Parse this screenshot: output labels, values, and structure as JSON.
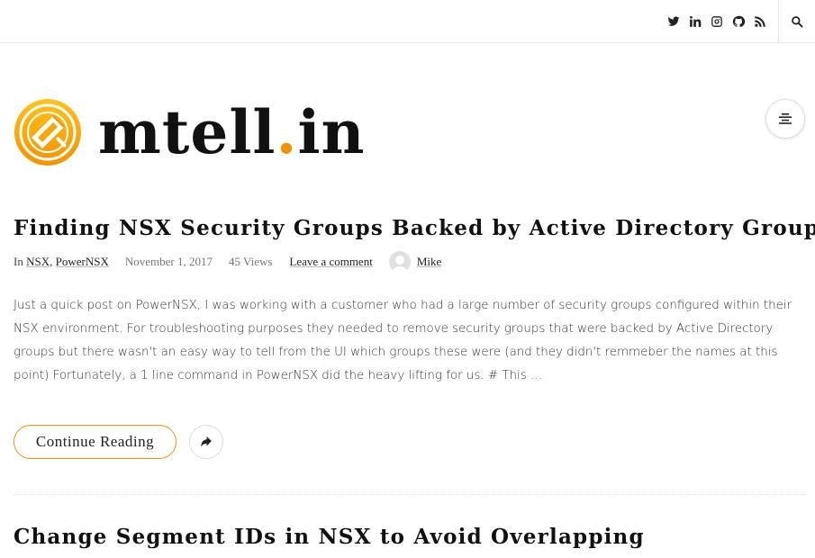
{
  "topbar": {
    "social_icons": [
      "twitter-icon",
      "linkedin-icon",
      "instagram-icon",
      "github-icon",
      "rss-icon"
    ],
    "search_icon": "search-icon"
  },
  "header": {
    "logo_name": "mtell",
    "logo_dot": ".",
    "logo_tld": "in",
    "menu_icon": "menu-icon"
  },
  "colors": {
    "accent": "#f39200",
    "text": "#111111",
    "border": "#e6e6e6"
  },
  "posts": [
    {
      "title": "Finding NSX Security Groups Backed by Active Directory Groups",
      "meta": {
        "in_label": "In",
        "categories": [
          "NSX",
          "PowerNSX"
        ],
        "separator": ",",
        "date": "November 1, 2017",
        "views": "45 Views",
        "comment_link": "Leave a comment",
        "author": "Mike"
      },
      "excerpt": "Just a quick post on PowerNSX, I was working with a customer who had a large number of security groups configured within their NSX environment. For troubleshooting purposes they needed to remove security groups that were backed by Active Directory groups but there wasn't an easy way to tell from the UI which groups these were (and they didn't remmeber the names at this point) Fortunately, a 1 line command in PowerNSX did the heavy lifting for us. # This …",
      "continue_label": "Continue Reading",
      "share_icon": "share-icon"
    },
    {
      "title": "Change Segment IDs in NSX to Avoid Overlapping"
    }
  ]
}
